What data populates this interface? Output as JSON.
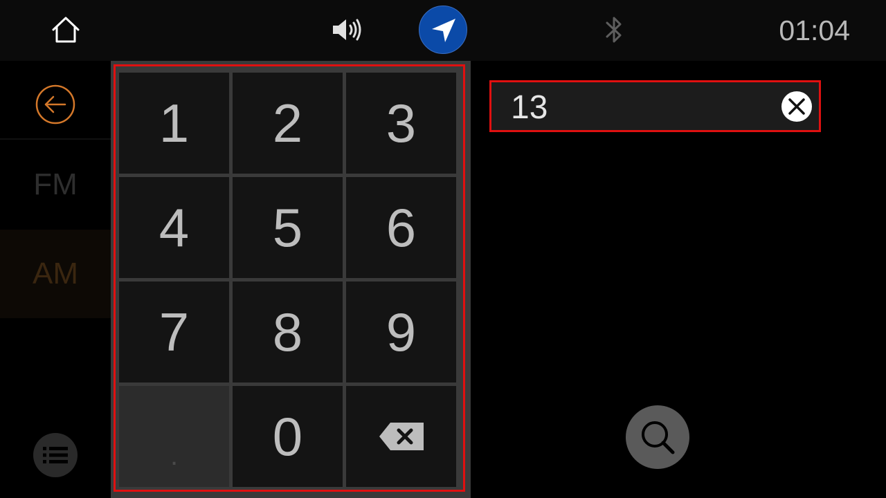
{
  "status_bar": {
    "time": "01:04",
    "icons": [
      "home-icon",
      "volume-icon",
      "navigation-icon",
      "bluetooth-icon"
    ],
    "nav_button_color": "#0b4aa8"
  },
  "sidebar": {
    "back_icon": "back-arrow-icon",
    "bands": [
      {
        "label": "FM",
        "selected": false
      },
      {
        "label": "AM",
        "selected": true
      }
    ],
    "list_icon": "list-icon",
    "accent_color": "#d4782a"
  },
  "keypad": {
    "keys": [
      "1",
      "2",
      "3",
      "4",
      "5",
      "6",
      "7",
      "8",
      "9",
      ".",
      "0"
    ],
    "backspace_icon": "backspace-icon",
    "highlight_color": "#e01010"
  },
  "entry": {
    "value": "13",
    "clear_icon": "clear-icon"
  },
  "search": {
    "icon": "search-icon"
  }
}
